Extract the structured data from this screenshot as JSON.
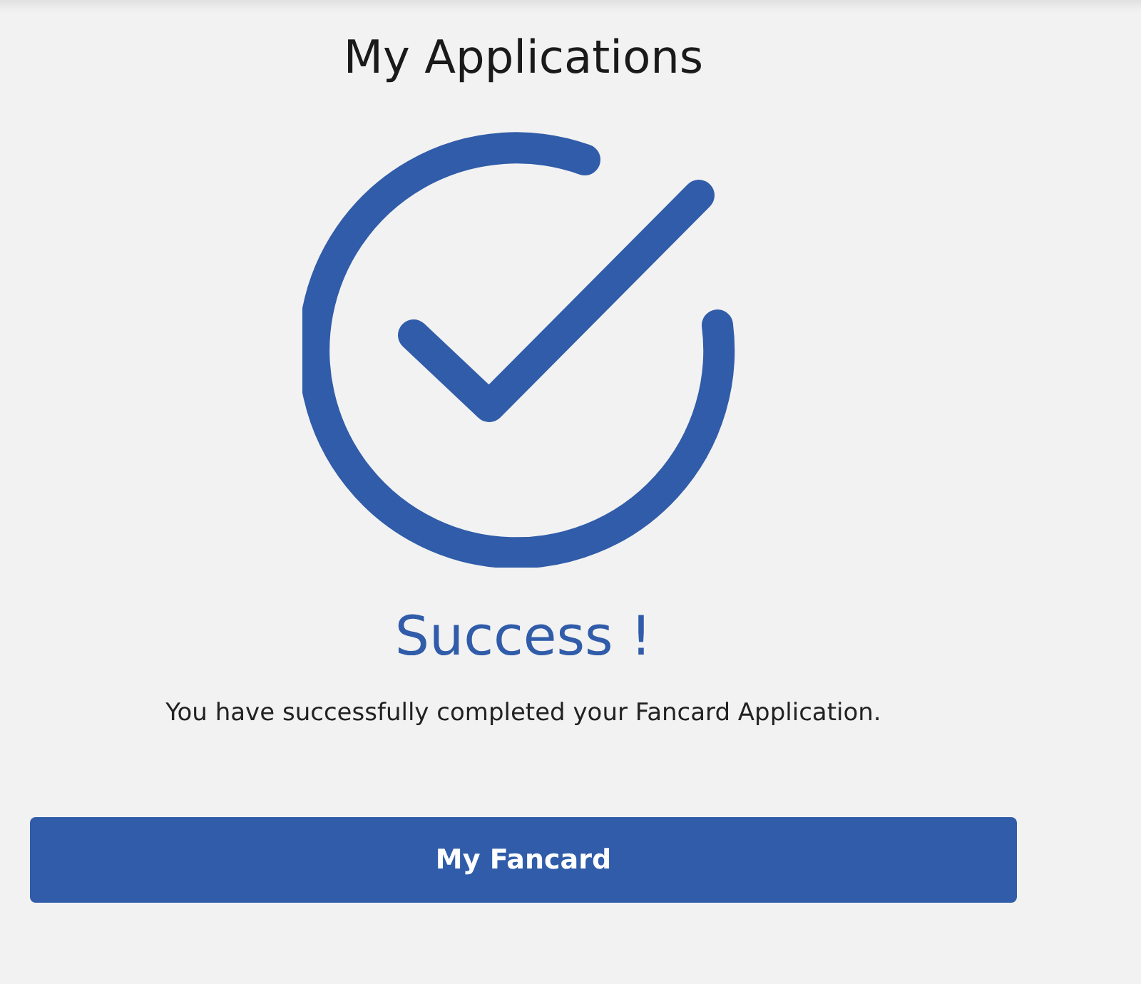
{
  "page_title": "My Applications",
  "result": {
    "heading": "Success !",
    "message": "You have successfully completed your Fancard Application."
  },
  "button": {
    "label": "My Fancard"
  }
}
